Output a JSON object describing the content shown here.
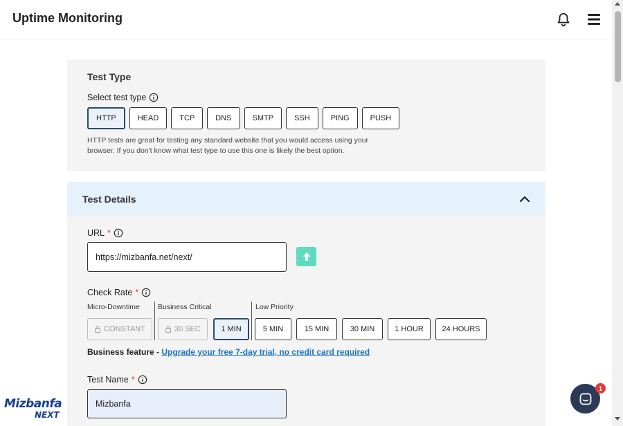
{
  "header": {
    "title": "Uptime Monitoring",
    "bell_icon": "bell-icon",
    "menu_icon": "hamburger-menu-icon"
  },
  "test_type": {
    "title": "Test Type",
    "select_label": "Select test type",
    "options": [
      "HTTP",
      "HEAD",
      "TCP",
      "DNS",
      "SMTP",
      "SSH",
      "PING",
      "PUSH"
    ],
    "selected": "HTTP",
    "description": "HTTP tests are great for testing any standard website that you would access using your browser. If you don't know what test type to use this one is likely the best option."
  },
  "test_details": {
    "title": "Test Details",
    "url_label": "URL",
    "url_value": "https://mizbanfa.net/next/",
    "required_mark": "*",
    "check_rate_label": "Check Rate",
    "groups": {
      "micro": "Micro-Downtime",
      "business": "Business Critical",
      "low": "Low Priority"
    },
    "rates": {
      "constant": "CONSTANT",
      "sec30": "30 SEC",
      "min1": "1 MIN",
      "min5": "5 MIN",
      "min15": "15 MIN",
      "min30": "30 MIN",
      "hour1": "1 HOUR",
      "hours24": "24 HOURS"
    },
    "selected_rate": "1 MIN",
    "business_feature_label": "Business feature - ",
    "business_feature_link": "Upgrade your free 7-day trial, no credit card required",
    "test_name_label": "Test Name",
    "test_name_value": "Mizbanfa"
  },
  "chat": {
    "badge_count": "1"
  },
  "logo": {
    "top": "Mizbanfa",
    "bottom": "NEXT"
  },
  "colors": {
    "accent": "#2b4a6b",
    "link": "#1a73c9",
    "upload_button": "#5fdcc0",
    "details_header_bg": "#e5f1fb",
    "chat_bg": "#2c3a57",
    "badge": "#e53935"
  }
}
